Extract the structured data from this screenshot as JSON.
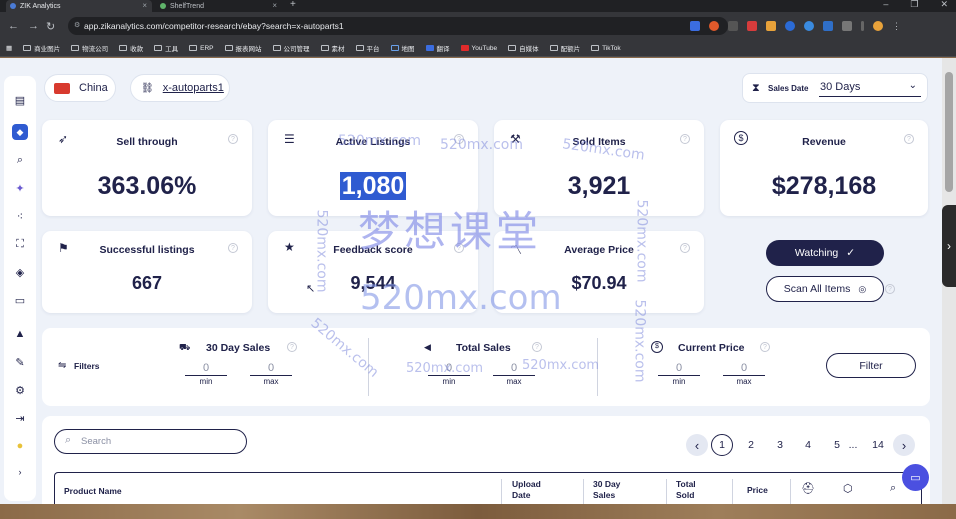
{
  "browser": {
    "tabs": [
      {
        "label": "ZIK Analytics",
        "active": true
      },
      {
        "label": "ShelfTrend",
        "active": false
      }
    ],
    "url": "app.zikanalytics.com/competitor-research/ebay?search=x-autoparts1",
    "bookmarks": [
      "商业图片",
      "物流公司",
      "收款",
      "工具",
      "ERP",
      "报表网站",
      "公司管理",
      "素材",
      "平台",
      "地图",
      "翻译",
      "YouTube",
      "自媒体",
      "配额片",
      "TikTok"
    ]
  },
  "header": {
    "country": "China",
    "store": "x-autoparts1",
    "sales_date_label": "Sales Date",
    "sales_date_value": "30 Days"
  },
  "stats": {
    "sell_through": {
      "title": "Sell through",
      "value": "363.06%"
    },
    "active_listings": {
      "title": "Active Listings",
      "value": "1,080"
    },
    "sold_items": {
      "title": "Sold Items",
      "value": "3,921"
    },
    "revenue": {
      "title": "Revenue",
      "value": "$278,168"
    },
    "successful_listings": {
      "title": "Successful listings",
      "value": "667"
    },
    "feedback_score": {
      "title": "Feedback score",
      "value": "9,544"
    },
    "average_price": {
      "title": "Average Price",
      "value": "$70.94"
    }
  },
  "actions": {
    "watching": "Watching",
    "scan_all": "Scan All Items"
  },
  "filters": {
    "label": "Filters",
    "groups": [
      {
        "title": "30 Day Sales",
        "min": "0",
        "max": "0"
      },
      {
        "title": "Total Sales",
        "min": "0",
        "max": "0"
      },
      {
        "title": "Current Price",
        "min": "0",
        "max": "0"
      }
    ],
    "min_label": "min",
    "max_label": "max",
    "button": "Filter"
  },
  "table": {
    "search_placeholder": "Search",
    "pagination": {
      "prev": "‹",
      "pages": [
        "1",
        "2",
        "3",
        "4",
        "5",
        "...",
        "14"
      ],
      "current": "1",
      "next": "›"
    },
    "columns": [
      "Product Name",
      "Upload Date",
      "30 Day Sales",
      "Total Sold",
      "Price"
    ]
  },
  "watermarks": [
    "520mx.com",
    "520mx.com",
    "520mx.com",
    "梦想课堂",
    "520mx.com",
    "520mx.com",
    "520mx.com",
    "520mx.com",
    "520mx.com",
    "520mx.com"
  ],
  "colors": {
    "navy": "#20224a",
    "accent": "#2f5bd1",
    "bg": "#eef2f9"
  }
}
